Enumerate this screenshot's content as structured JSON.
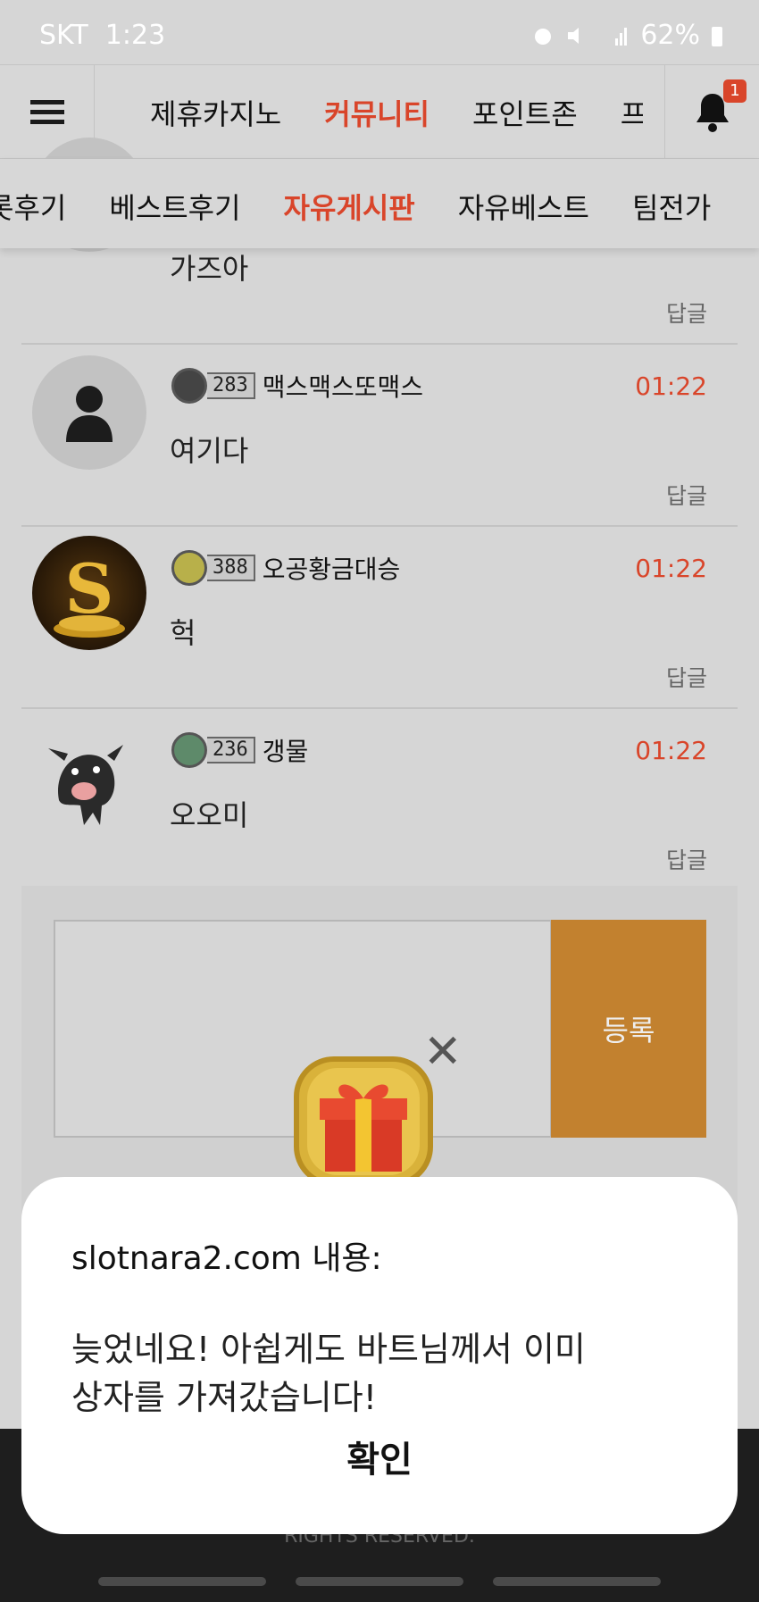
{
  "status_bar": {
    "carrier": "SKT",
    "time": "1:23",
    "battery": "62%"
  },
  "top_nav": {
    "tabs": [
      "제휴카지노",
      "커뮤니티",
      "포인트존",
      "프"
    ],
    "active": "커뮤니티",
    "notification_count": "1"
  },
  "sub_nav": {
    "tabs": [
      "롯후기",
      "베스트후기",
      "자유게시판",
      "자유베스트",
      "팀전가"
    ],
    "active": "자유게시판"
  },
  "comments": [
    {
      "body": "가즈아",
      "reply": "답글"
    },
    {
      "level": "283",
      "nick": "맥스맥스또맥스",
      "time": "01:22",
      "body": "여기다",
      "reply": "답글",
      "avatar": "default-avatar"
    },
    {
      "level": "388",
      "nick": "오공황금대승",
      "time": "01:22",
      "body": "헉",
      "reply": "답글",
      "avatar": "gold-s-coin-avatar"
    },
    {
      "level": "236",
      "nick": "갱물",
      "time": "01:22",
      "body": "오오미",
      "reply": "답글",
      "avatar": "cow-avatar"
    }
  ],
  "reply_form": {
    "submit_label": "등록"
  },
  "footer": {
    "rights": "RIGHTS RESERVED."
  },
  "dialog": {
    "title": "slotnara2.com 내용:",
    "message_line1": "늦었네요! 아쉽게도 바트님께서 이미",
    "message_line2": "상자를 가져갔습니다!",
    "ok_label": "확인"
  },
  "colors": {
    "accent": "#d9452a",
    "submit": "#c2812f"
  }
}
